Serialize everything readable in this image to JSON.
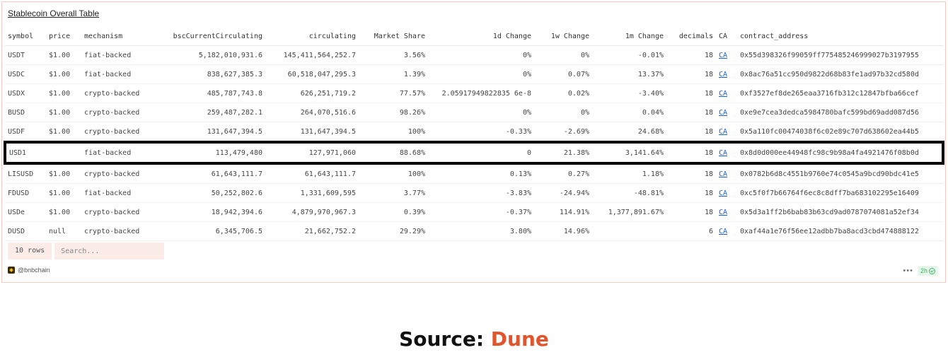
{
  "table_title": "Stablecoin Overall Table",
  "columns": [
    "symbol",
    "price",
    "mechanism",
    "bscCurrentCirculating",
    "circulating",
    "Market Share",
    "1d Change",
    "1w Change",
    "1m Change",
    "decimals",
    "CA",
    "contract_address"
  ],
  "rows": [
    {
      "symbol": "USDT",
      "price": "$1.00",
      "mechanism": "fiat-backed",
      "bsc": "5,182,010,931.6",
      "circ": "145,411,564,252.7",
      "share": "3.56%",
      "d1": "0%",
      "w1": "0%",
      "m1": "-0.01%",
      "decimals": "18",
      "ca": "CA",
      "address": "0x55d398326f99059ff775485246999027b3197955"
    },
    {
      "symbol": "USDC",
      "price": "$1.00",
      "mechanism": "fiat-backed",
      "bsc": "838,627,385.3",
      "circ": "60,518,047,295.3",
      "share": "1.39%",
      "d1": "0%",
      "w1": "0.07%",
      "m1": "13.37%",
      "decimals": "18",
      "ca": "CA",
      "address": "0x8ac76a51cc950d9822d68b83fe1ad97b32cd580d"
    },
    {
      "symbol": "USDX",
      "price": "$1.00",
      "mechanism": "crypto-backed",
      "bsc": "485,787,743.8",
      "circ": "626,251,719.2",
      "share": "77.57%",
      "d1": "2.05917949822835 6e-8",
      "w1": "0.02%",
      "m1": "-3.40%",
      "decimals": "18",
      "ca": "CA",
      "address": "0xf3527ef8de265eaa3716fb312c12847bfba66cef"
    },
    {
      "symbol": "BUSD",
      "price": "$1.00",
      "mechanism": "crypto-backed",
      "bsc": "259,487,282.1",
      "circ": "264,070,516.6",
      "share": "98.26%",
      "d1": "0%",
      "w1": "0%",
      "m1": "0.04%",
      "decimals": "18",
      "ca": "CA",
      "address": "0xe9e7cea3dedca5984780bafc599bd69add087d56"
    },
    {
      "symbol": "USDF",
      "price": "$1.00",
      "mechanism": "crypto-backed",
      "bsc": "131,647,394.5",
      "circ": "131,647,394.5",
      "share": "100%",
      "d1": "-0.33%",
      "w1": "-2.69%",
      "m1": "24.68%",
      "decimals": "18",
      "ca": "CA",
      "address": "0x5a110fc00474038f6c02e89c707d638602ea44b5"
    },
    {
      "symbol": "USD1",
      "price": "",
      "mechanism": "fiat-backed",
      "bsc": "113,479,480",
      "circ": "127,971,060",
      "share": "88.68%",
      "d1": "0",
      "w1": "21.38%",
      "m1": "3,141.64%",
      "decimals": "18",
      "ca": "CA",
      "address": "0x8d0d000ee44948fc98c9b98a4fa4921476f08b0d"
    },
    {
      "symbol": "LISUSD",
      "price": "$1.00",
      "mechanism": "crypto-backed",
      "bsc": "61,643,111.7",
      "circ": "61,643,111.7",
      "share": "100%",
      "d1": "0.13%",
      "w1": "0.27%",
      "m1": "1.18%",
      "decimals": "18",
      "ca": "CA",
      "address": "0x0782b6d8c4551b9760e74c0545a9bcd90bdc41e5"
    },
    {
      "symbol": "FDUSD",
      "price": "$1.00",
      "mechanism": "fiat-backed",
      "bsc": "50,252,802.6",
      "circ": "1,331,609,595",
      "share": "3.77%",
      "d1": "-3.83%",
      "w1": "-24.94%",
      "m1": "-48.81%",
      "decimals": "18",
      "ca": "CA",
      "address": "0xc5f0f7b66764f6ec8c8dff7ba683102295e16409"
    },
    {
      "symbol": "USDe",
      "price": "$1.00",
      "mechanism": "crypto-backed",
      "bsc": "18,942,394.6",
      "circ": "4,879,970,967.3",
      "share": "0.39%",
      "d1": "-0.37%",
      "w1": "114.91%",
      "m1": "1,377,891.67%",
      "decimals": "18",
      "ca": "CA",
      "address": "0x5d3a1ff2b6bab83b63cd9ad0787074081a52ef34"
    },
    {
      "symbol": "DUSD",
      "price": "null",
      "mechanism": "crypto-backed",
      "bsc": "6,345,706.5",
      "circ": "21,662,752.2",
      "share": "29.29%",
      "d1": "3.80%",
      "w1": "14.96%",
      "m1": "",
      "decimals": "6",
      "ca": "CA",
      "address": "0xaf44a1e76f56ee12adbb7ba8acd3cbd474888122"
    }
  ],
  "highlighted_row": "USD1",
  "footer": {
    "rows_count": "10 rows",
    "search_placeholder": "Search...",
    "author": "@bnbchain",
    "more": "•••",
    "age": "2h"
  },
  "source": {
    "prefix": "Source: ",
    "name": "Dune"
  },
  "colors": {
    "positive": "#3fb56a",
    "negative": "#e25a45",
    "link": "#1a5fd6",
    "brand": "#e0552c",
    "border": "#f3cbbf"
  }
}
